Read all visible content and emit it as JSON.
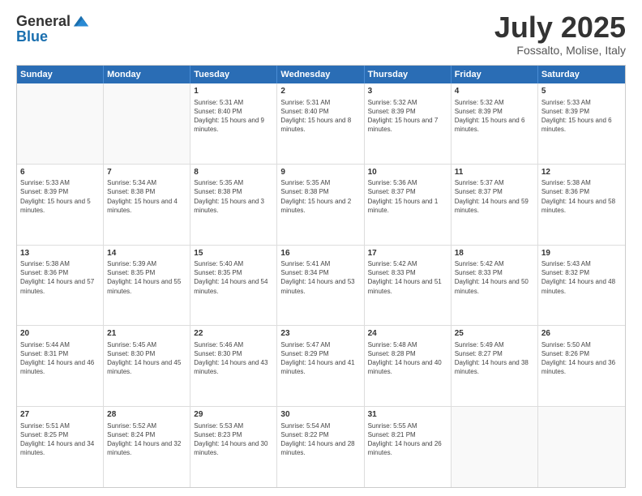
{
  "header": {
    "logo_line1": "General",
    "logo_line2": "Blue",
    "month": "July 2025",
    "location": "Fossalto, Molise, Italy"
  },
  "days_of_week": [
    "Sunday",
    "Monday",
    "Tuesday",
    "Wednesday",
    "Thursday",
    "Friday",
    "Saturday"
  ],
  "weeks": [
    [
      {
        "day": "",
        "info": ""
      },
      {
        "day": "",
        "info": ""
      },
      {
        "day": "1",
        "info": "Sunrise: 5:31 AM\nSunset: 8:40 PM\nDaylight: 15 hours and 9 minutes."
      },
      {
        "day": "2",
        "info": "Sunrise: 5:31 AM\nSunset: 8:40 PM\nDaylight: 15 hours and 8 minutes."
      },
      {
        "day": "3",
        "info": "Sunrise: 5:32 AM\nSunset: 8:39 PM\nDaylight: 15 hours and 7 minutes."
      },
      {
        "day": "4",
        "info": "Sunrise: 5:32 AM\nSunset: 8:39 PM\nDaylight: 15 hours and 6 minutes."
      },
      {
        "day": "5",
        "info": "Sunrise: 5:33 AM\nSunset: 8:39 PM\nDaylight: 15 hours and 6 minutes."
      }
    ],
    [
      {
        "day": "6",
        "info": "Sunrise: 5:33 AM\nSunset: 8:39 PM\nDaylight: 15 hours and 5 minutes."
      },
      {
        "day": "7",
        "info": "Sunrise: 5:34 AM\nSunset: 8:38 PM\nDaylight: 15 hours and 4 minutes."
      },
      {
        "day": "8",
        "info": "Sunrise: 5:35 AM\nSunset: 8:38 PM\nDaylight: 15 hours and 3 minutes."
      },
      {
        "day": "9",
        "info": "Sunrise: 5:35 AM\nSunset: 8:38 PM\nDaylight: 15 hours and 2 minutes."
      },
      {
        "day": "10",
        "info": "Sunrise: 5:36 AM\nSunset: 8:37 PM\nDaylight: 15 hours and 1 minute."
      },
      {
        "day": "11",
        "info": "Sunrise: 5:37 AM\nSunset: 8:37 PM\nDaylight: 14 hours and 59 minutes."
      },
      {
        "day": "12",
        "info": "Sunrise: 5:38 AM\nSunset: 8:36 PM\nDaylight: 14 hours and 58 minutes."
      }
    ],
    [
      {
        "day": "13",
        "info": "Sunrise: 5:38 AM\nSunset: 8:36 PM\nDaylight: 14 hours and 57 minutes."
      },
      {
        "day": "14",
        "info": "Sunrise: 5:39 AM\nSunset: 8:35 PM\nDaylight: 14 hours and 55 minutes."
      },
      {
        "day": "15",
        "info": "Sunrise: 5:40 AM\nSunset: 8:35 PM\nDaylight: 14 hours and 54 minutes."
      },
      {
        "day": "16",
        "info": "Sunrise: 5:41 AM\nSunset: 8:34 PM\nDaylight: 14 hours and 53 minutes."
      },
      {
        "day": "17",
        "info": "Sunrise: 5:42 AM\nSunset: 8:33 PM\nDaylight: 14 hours and 51 minutes."
      },
      {
        "day": "18",
        "info": "Sunrise: 5:42 AM\nSunset: 8:33 PM\nDaylight: 14 hours and 50 minutes."
      },
      {
        "day": "19",
        "info": "Sunrise: 5:43 AM\nSunset: 8:32 PM\nDaylight: 14 hours and 48 minutes."
      }
    ],
    [
      {
        "day": "20",
        "info": "Sunrise: 5:44 AM\nSunset: 8:31 PM\nDaylight: 14 hours and 46 minutes."
      },
      {
        "day": "21",
        "info": "Sunrise: 5:45 AM\nSunset: 8:30 PM\nDaylight: 14 hours and 45 minutes."
      },
      {
        "day": "22",
        "info": "Sunrise: 5:46 AM\nSunset: 8:30 PM\nDaylight: 14 hours and 43 minutes."
      },
      {
        "day": "23",
        "info": "Sunrise: 5:47 AM\nSunset: 8:29 PM\nDaylight: 14 hours and 41 minutes."
      },
      {
        "day": "24",
        "info": "Sunrise: 5:48 AM\nSunset: 8:28 PM\nDaylight: 14 hours and 40 minutes."
      },
      {
        "day": "25",
        "info": "Sunrise: 5:49 AM\nSunset: 8:27 PM\nDaylight: 14 hours and 38 minutes."
      },
      {
        "day": "26",
        "info": "Sunrise: 5:50 AM\nSunset: 8:26 PM\nDaylight: 14 hours and 36 minutes."
      }
    ],
    [
      {
        "day": "27",
        "info": "Sunrise: 5:51 AM\nSunset: 8:25 PM\nDaylight: 14 hours and 34 minutes."
      },
      {
        "day": "28",
        "info": "Sunrise: 5:52 AM\nSunset: 8:24 PM\nDaylight: 14 hours and 32 minutes."
      },
      {
        "day": "29",
        "info": "Sunrise: 5:53 AM\nSunset: 8:23 PM\nDaylight: 14 hours and 30 minutes."
      },
      {
        "day": "30",
        "info": "Sunrise: 5:54 AM\nSunset: 8:22 PM\nDaylight: 14 hours and 28 minutes."
      },
      {
        "day": "31",
        "info": "Sunrise: 5:55 AM\nSunset: 8:21 PM\nDaylight: 14 hours and 26 minutes."
      },
      {
        "day": "",
        "info": ""
      },
      {
        "day": "",
        "info": ""
      }
    ]
  ]
}
